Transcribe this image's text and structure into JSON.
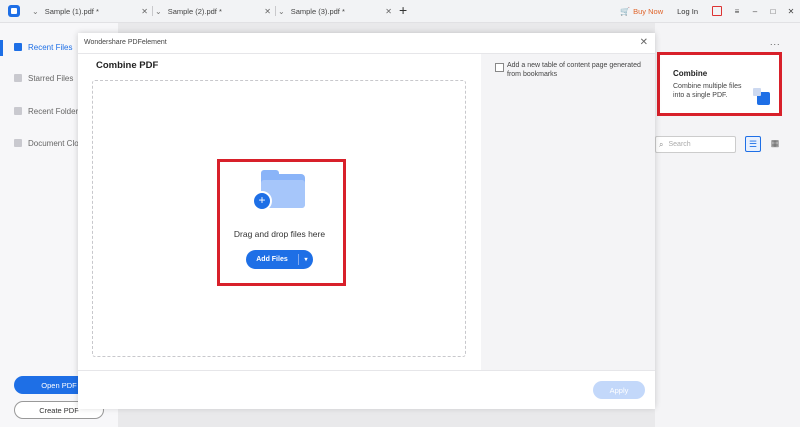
{
  "tabs": [
    {
      "label": "Sample (1).pdf *"
    },
    {
      "label": "Sample (2).pdf *"
    },
    {
      "label": "Sample (3).pdf *"
    }
  ],
  "topbar": {
    "buy_now": "Buy Now",
    "login": "Log In"
  },
  "sidebar": {
    "items": [
      {
        "label": "Recent Files"
      },
      {
        "label": "Starred Files"
      },
      {
        "label": "Recent Folder"
      },
      {
        "label": "Document Clo"
      }
    ],
    "open_pdf": "Open PDF",
    "create_pdf": "Create PDF"
  },
  "right_panel": {
    "more": "...",
    "combine_title": "Combine",
    "combine_desc": "Combine multiple files into a single PDF.",
    "search_placeholder": "Search"
  },
  "modal": {
    "window_title": "Wondershare PDFelement",
    "heading": "Combine PDF",
    "drop_text": "Drag and drop files here",
    "add_files": "Add Files",
    "option_label": "Add a new table of content page generated from bookmarks",
    "apply": "Apply"
  },
  "colors": {
    "accent": "#1e6fe6",
    "highlight_box": "#d8202a",
    "buy_now": "#e0642a"
  }
}
